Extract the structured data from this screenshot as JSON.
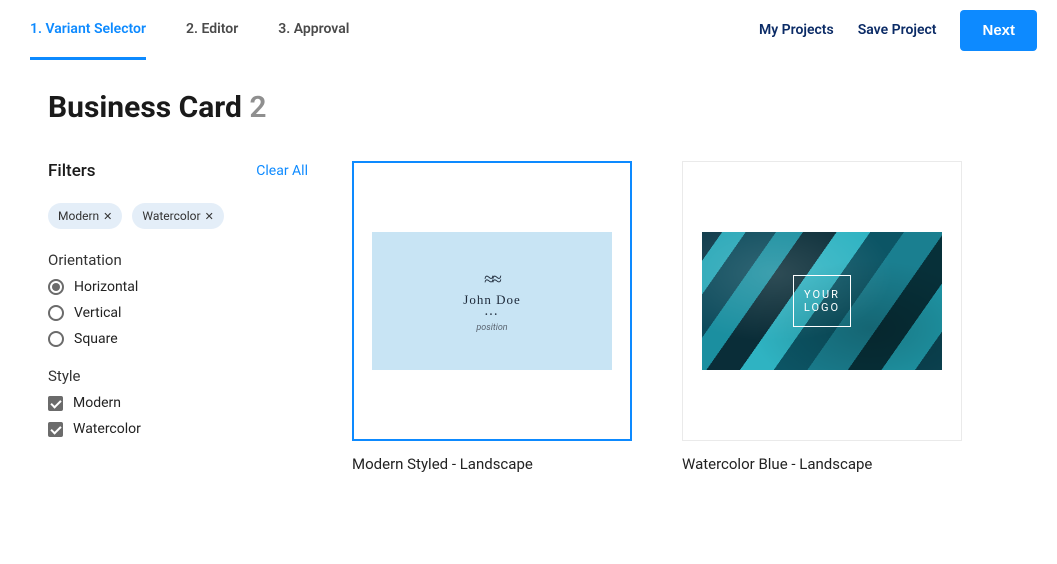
{
  "steps": [
    {
      "label": "1. Variant Selector",
      "active": true
    },
    {
      "label": "2. Editor",
      "active": false
    },
    {
      "label": "3. Approval",
      "active": false
    }
  ],
  "top_actions": {
    "my_projects": "My Projects",
    "save_project": "Save Project",
    "next": "Next"
  },
  "page": {
    "title": "Business Card",
    "count": "2"
  },
  "filters": {
    "title": "Filters",
    "clear_all": "Clear All",
    "chips": [
      {
        "label": "Modern"
      },
      {
        "label": "Watercolor"
      }
    ],
    "orientation": {
      "title": "Orientation",
      "options": [
        {
          "label": "Horizontal",
          "checked": true
        },
        {
          "label": "Vertical",
          "checked": false
        },
        {
          "label": "Square",
          "checked": false
        }
      ]
    },
    "style": {
      "title": "Style",
      "options": [
        {
          "label": "Modern",
          "checked": true
        },
        {
          "label": "Watercolor",
          "checked": true
        }
      ]
    }
  },
  "cards": [
    {
      "caption": "Modern Styled - Landscape",
      "selected": true,
      "preview": {
        "name": "John Doe",
        "position": "position"
      }
    },
    {
      "caption": "Watercolor Blue - Landscape",
      "selected": false,
      "preview": {
        "logo_line1": "YOUR",
        "logo_line2": "LOGO"
      }
    }
  ]
}
